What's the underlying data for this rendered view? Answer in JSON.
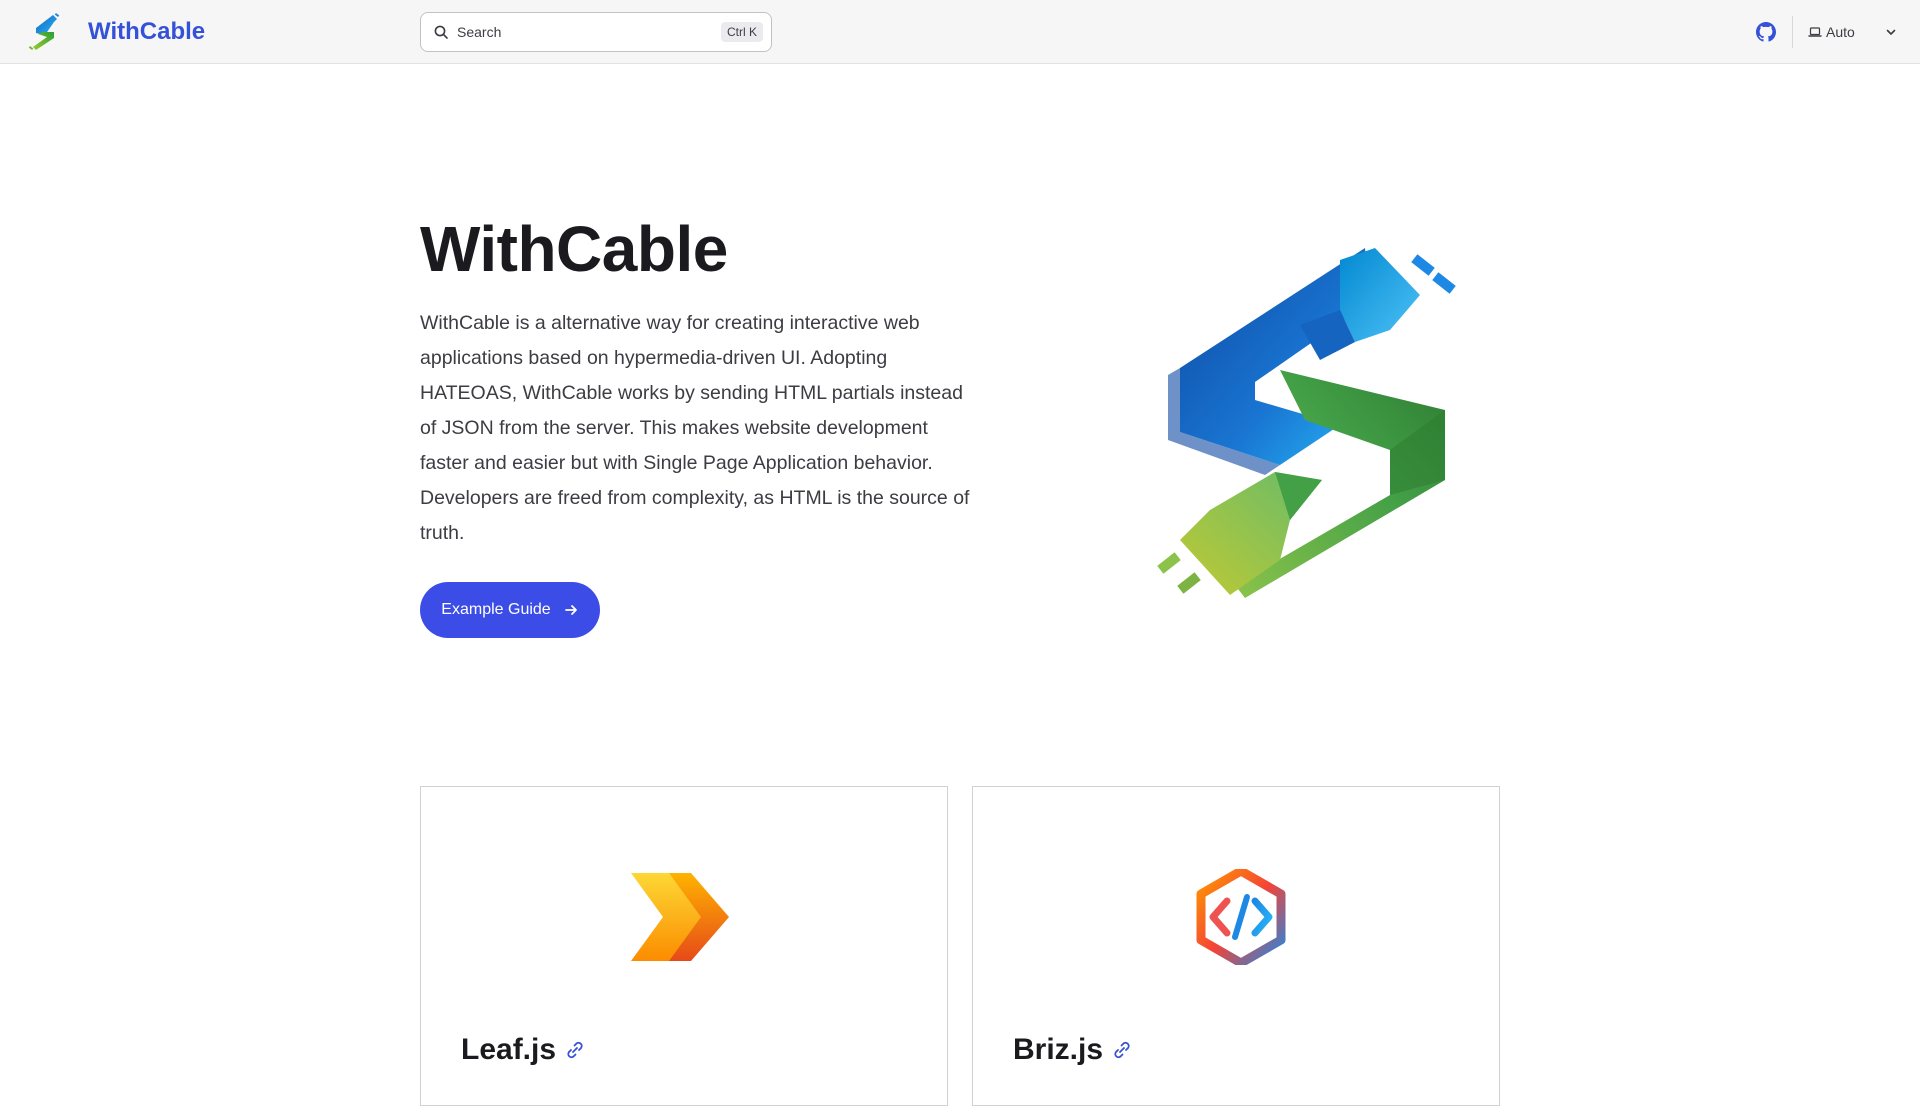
{
  "header": {
    "brand_name": "WithCable",
    "search_placeholder": "Search",
    "search_shortcut": "Ctrl K",
    "theme_label": "Auto",
    "github_icon": "github-icon"
  },
  "hero": {
    "title": "WithCable",
    "description": "WithCable is a alternative way for creating interactive web applications based on hypermedia-driven UI. Adopting HATEOAS, WithCable works by sending HTML partials instead of JSON from the server. This makes website development faster and easier but with Single Page Application behavior. Developers are freed from complexity, as HTML is the source of truth.",
    "cta_label": "Example Guide"
  },
  "features": [
    {
      "title": "Leaf.js",
      "icon": "chevron-arrow-icon"
    },
    {
      "title": "Briz.js",
      "icon": "code-hexagon-icon"
    }
  ],
  "colors": {
    "brand": "#3451d8",
    "cta": "#3c4de7",
    "header_bg": "#f6f6f7"
  }
}
